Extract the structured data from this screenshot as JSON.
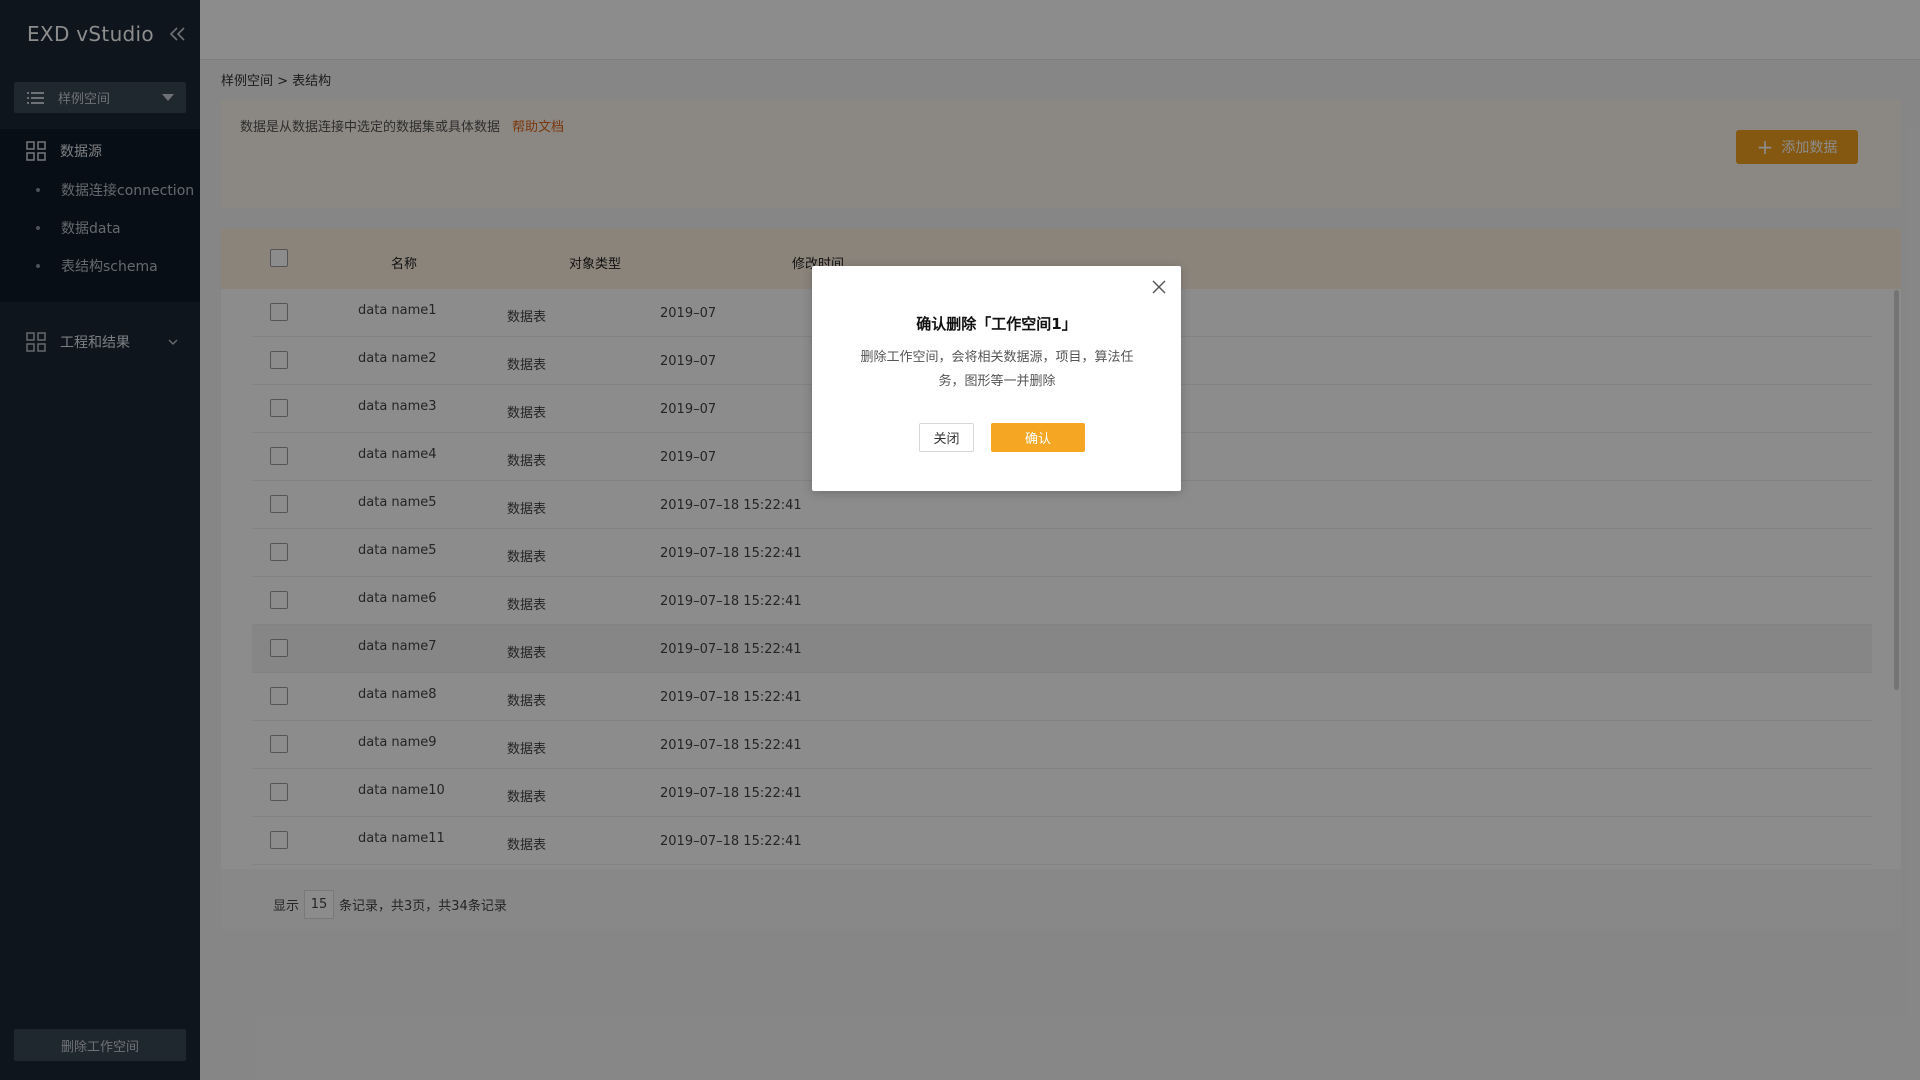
{
  "app": {
    "title": "EXD vStudio"
  },
  "sidebar": {
    "workspace_select": "样例空间",
    "section_datasource": "数据源",
    "sub_items": [
      {
        "label": "数据连接connection"
      },
      {
        "label": "数据data"
      },
      {
        "label": "表结构schema"
      }
    ],
    "section_projects": "工程和结果",
    "delete_workspace": "删除工作空间"
  },
  "breadcrumb": "样例空间 > 表结构",
  "info": {
    "text": "数据是从数据连接中选定的数据集或具体数据",
    "help_link": "帮助文档",
    "add_button": "添加数据"
  },
  "table": {
    "columns": [
      "名称",
      "对象类型",
      "修改时间"
    ],
    "rows": [
      {
        "name": "data name1",
        "type": "数据表",
        "time": "2019–07"
      },
      {
        "name": "data name2",
        "type": "数据表",
        "time": "2019–07"
      },
      {
        "name": "data name3",
        "type": "数据表",
        "time": "2019–07"
      },
      {
        "name": "data name4",
        "type": "数据表",
        "time": "2019–07"
      },
      {
        "name": "data name5",
        "type": "数据表",
        "time": "2019–07–18 15:22:41"
      },
      {
        "name": "data name5",
        "type": "数据表",
        "time": "2019–07–18 15:22:41"
      },
      {
        "name": "data name6",
        "type": "数据表",
        "time": "2019–07–18 15:22:41"
      },
      {
        "name": "data name7",
        "type": "数据表",
        "time": "2019–07–18 15:22:41"
      },
      {
        "name": "data name8",
        "type": "数据表",
        "time": "2019–07–18 15:22:41"
      },
      {
        "name": "data name9",
        "type": "数据表",
        "time": "2019–07–18 15:22:41"
      },
      {
        "name": "data name10",
        "type": "数据表",
        "time": "2019–07–18 15:22:41"
      },
      {
        "name": "data name11",
        "type": "数据表",
        "time": "2019–07–18 15:22:41"
      }
    ]
  },
  "pagination": {
    "prefix": "显示",
    "page_size": "15",
    "suffix": "条记录，共3页，共34条记录"
  },
  "dialog": {
    "title": "确认删除「工作空间1」",
    "body": "删除工作空间，会将相关数据源，项目，算法任务，图形等一并删除",
    "cancel": "关闭",
    "confirm": "确认"
  },
  "colors": {
    "sidebar_bg": "#1a2735",
    "accent": "#f0a01e",
    "link": "#e0661a"
  }
}
